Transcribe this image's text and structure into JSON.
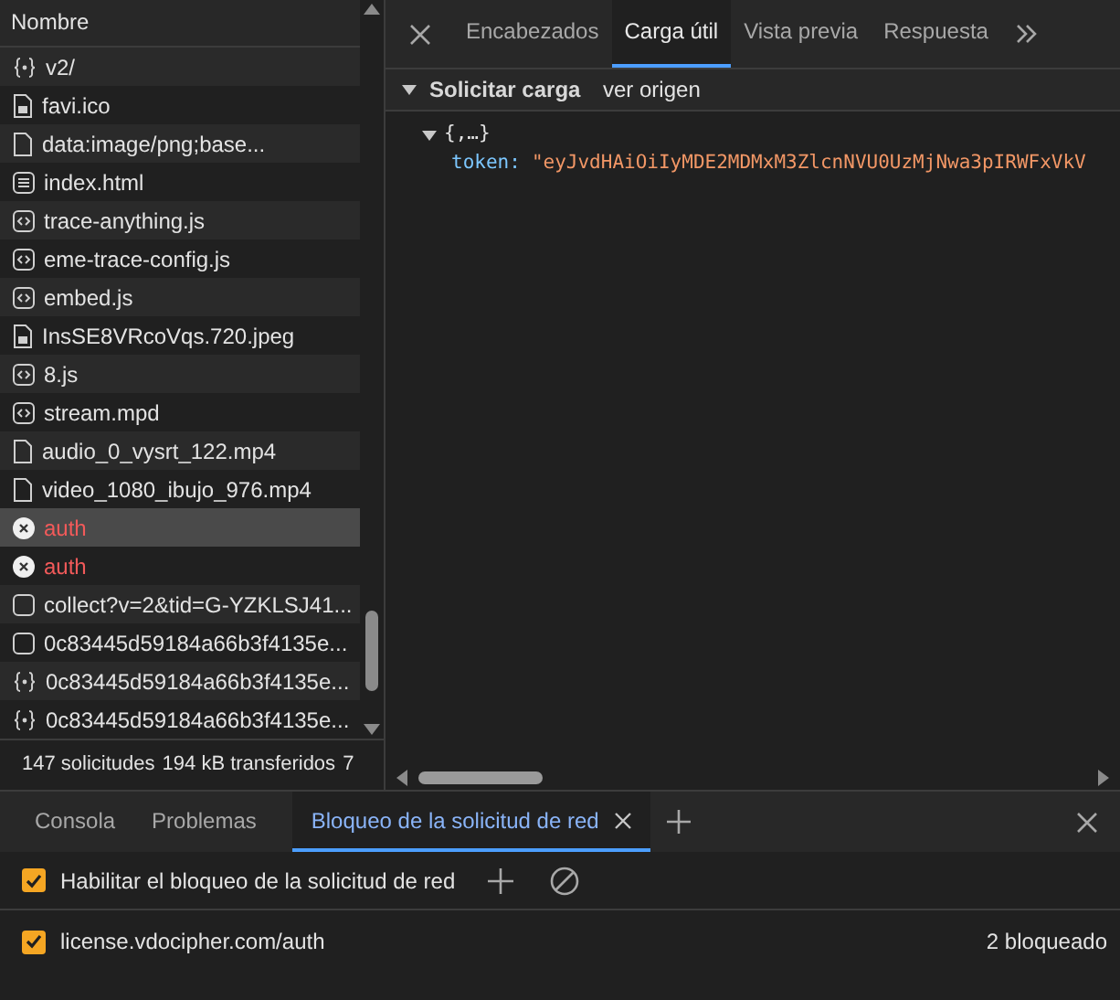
{
  "requests": {
    "column": "Nombre",
    "rows": [
      {
        "name": "v2/",
        "kind": "fetch",
        "selected": false,
        "failed": false
      },
      {
        "name": "favi.ico",
        "kind": "image",
        "selected": false,
        "failed": false
      },
      {
        "name": "data:image/png;base...",
        "kind": "file",
        "selected": false,
        "failed": false
      },
      {
        "name": "index.html",
        "kind": "document",
        "selected": false,
        "failed": false
      },
      {
        "name": "trace-anything.js",
        "kind": "script",
        "selected": false,
        "failed": false
      },
      {
        "name": "eme-trace-config.js",
        "kind": "script",
        "selected": false,
        "failed": false
      },
      {
        "name": "embed.js",
        "kind": "script",
        "selected": false,
        "failed": false
      },
      {
        "name": "InsSE8VRcoVqs.720.jpeg",
        "kind": "image",
        "selected": false,
        "failed": false
      },
      {
        "name": "8.js",
        "kind": "script",
        "selected": false,
        "failed": false
      },
      {
        "name": "stream.mpd",
        "kind": "script",
        "selected": false,
        "failed": false
      },
      {
        "name": "audio_0_vysrt_122.mp4",
        "kind": "file",
        "selected": false,
        "failed": false
      },
      {
        "name": "video_1080_ibujo_976.mp4",
        "kind": "file",
        "selected": false,
        "failed": false
      },
      {
        "name": "auth",
        "kind": "error",
        "selected": true,
        "failed": true
      },
      {
        "name": "auth",
        "kind": "error",
        "selected": false,
        "failed": true
      },
      {
        "name": "collect?v=2&tid=G-YZKLSJ41...",
        "kind": "other",
        "selected": false,
        "failed": false
      },
      {
        "name": "0c83445d59184a66b3f4135e...",
        "kind": "other",
        "selected": false,
        "failed": false
      },
      {
        "name": "0c83445d59184a66b3f4135e...",
        "kind": "fetch",
        "selected": false,
        "failed": false
      },
      {
        "name": "0c83445d59184a66b3f4135e...",
        "kind": "fetch",
        "selected": false,
        "failed": false
      }
    ]
  },
  "status_bar": [
    "147 solicitudes",
    "194 kB transferidos",
    "7"
  ],
  "detail": {
    "tabs": [
      {
        "label": "Encabezados",
        "selected": false
      },
      {
        "label": "Carga útil",
        "selected": true
      },
      {
        "label": "Vista previa",
        "selected": false
      },
      {
        "label": "Respuesta",
        "selected": false
      }
    ],
    "section": {
      "title": "Solicitar carga",
      "expanded": true,
      "link": "ver origen"
    },
    "payload": {
      "summary": "{,…}",
      "expanded": true,
      "key": "token:",
      "value": "\"eyJvdHAiOiIyMDE2MDMxM3ZlcnNVU0UzMjNwa3pIRWFxVkV"
    }
  },
  "drawer": {
    "tabs": [
      {
        "label": "Consola",
        "selected": false,
        "closable": false
      },
      {
        "label": "Problemas",
        "selected": false,
        "closable": false
      },
      {
        "label": "Bloqueo de la solicitud de red",
        "selected": true,
        "closable": true
      }
    ],
    "enable": {
      "label": "Habilitar el bloqueo de la solicitud de red",
      "checked": true
    },
    "patterns": [
      {
        "pattern": "license.vdocipher.com/auth",
        "checked": true,
        "count": "2 bloqueado"
      }
    ]
  }
}
